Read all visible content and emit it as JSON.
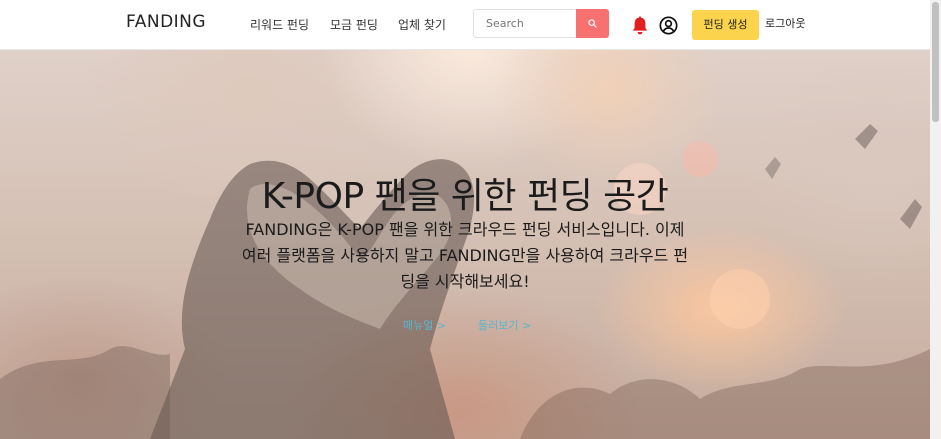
{
  "header": {
    "logo": "FANDING",
    "nav": {
      "reward": "리워드 펀딩",
      "donate": "모금 펀딩",
      "company": "업체 찾기"
    },
    "search": {
      "placeholder": "Search",
      "button_icon": "search-icon"
    },
    "icons": {
      "notification": "bell-icon",
      "profile": "user-circle-icon"
    },
    "create_button": "펀딩 생성",
    "logout": "로그아웃"
  },
  "hero": {
    "title": "K-POP 팬을 위한 펀딩 공간",
    "description": "FANDING은 K-POP 팬을 위한 크라우드 펀딩 서비스입니다. 이제 여러 플랫폼을 사용하지 말고 FANDING만을 사용하여 크라우드 펀딩을 시작해보세요!",
    "manual_link": "매뉴얼 >",
    "more_link": "둘러보기 >"
  },
  "colors": {
    "accent_search": "#f87171",
    "accent_create": "#fcd34d",
    "bell": "#e11d1d",
    "hero_link": "#5ab4cf"
  }
}
